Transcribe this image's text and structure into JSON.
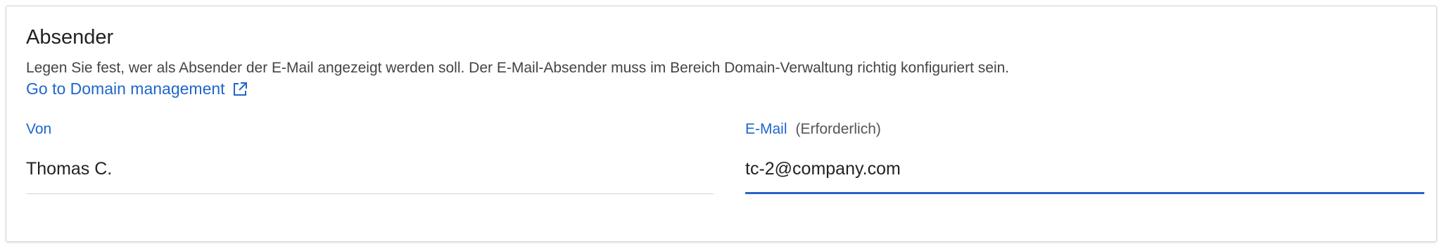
{
  "section": {
    "title": "Absender",
    "description": "Legen Sie fest, wer als Absender der E-Mail angezeigt werden soll. Der E-Mail-Absender muss im Bereich Domain-Verwaltung richtig konfiguriert sein.",
    "link_label": "Go to Domain management",
    "link_icon": "external-link-icon"
  },
  "fields": {
    "from": {
      "label": "Von",
      "value": "Thomas C."
    },
    "email": {
      "label": "E-Mail",
      "required_label": "(Erforderlich)",
      "value": "tc-2@company.com"
    }
  },
  "colors": {
    "accent": "#1f66cc",
    "focus_underline": "#2a62c9"
  }
}
